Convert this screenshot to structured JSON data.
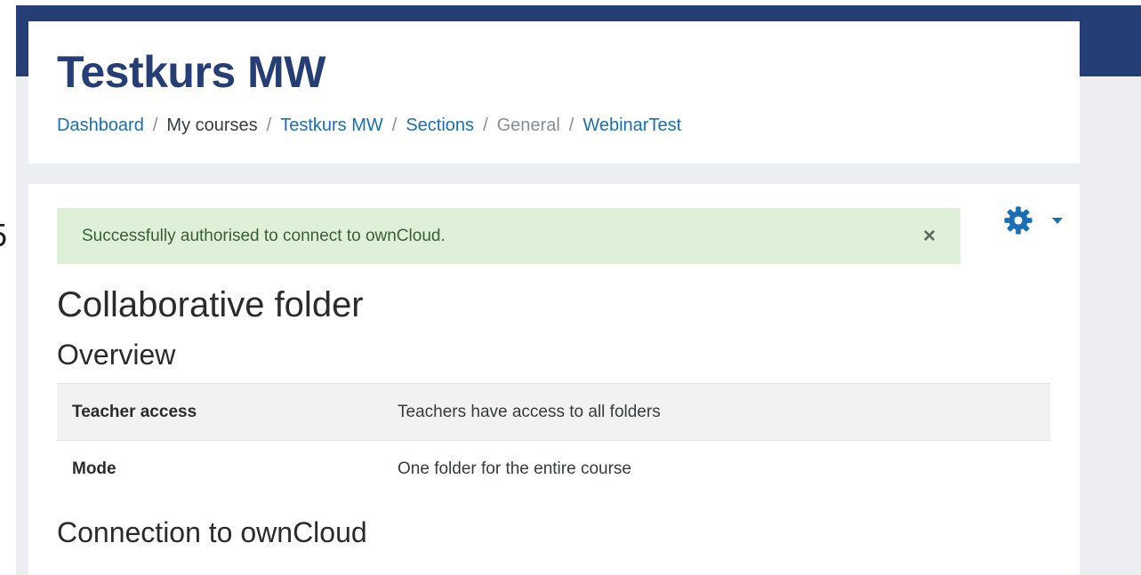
{
  "course": {
    "title": "Testkurs MW"
  },
  "breadcrumb": [
    {
      "label": "Dashboard",
      "kind": "link"
    },
    {
      "label": "My courses",
      "kind": "text"
    },
    {
      "label": "Testkurs MW",
      "kind": "link"
    },
    {
      "label": "Sections",
      "kind": "link"
    },
    {
      "label": "General",
      "kind": "muted"
    },
    {
      "label": "WebinarTest",
      "kind": "link"
    }
  ],
  "breadcrumb_separator": "/",
  "stray_glyph": "5",
  "alert": {
    "message": "Successfully authorised to connect to ownCloud.",
    "close_glyph": "×",
    "type": "success"
  },
  "actions_menu": {
    "icon": "gear-icon",
    "caret": "caret-down-icon"
  },
  "page": {
    "heading": "Collaborative folder",
    "overview_heading": "Overview",
    "connection_heading": "Connection to ownCloud"
  },
  "overview_table": [
    {
      "label": "Teacher access",
      "value": "Teachers have access to all folders"
    },
    {
      "label": "Mode",
      "value": "One folder for the entire course"
    }
  ],
  "colors": {
    "brand": "#253e75",
    "link": "#1a6fb4",
    "success_bg": "#dff0d8",
    "success_text": "#3a5e35",
    "page_bg": "#eceef1"
  }
}
